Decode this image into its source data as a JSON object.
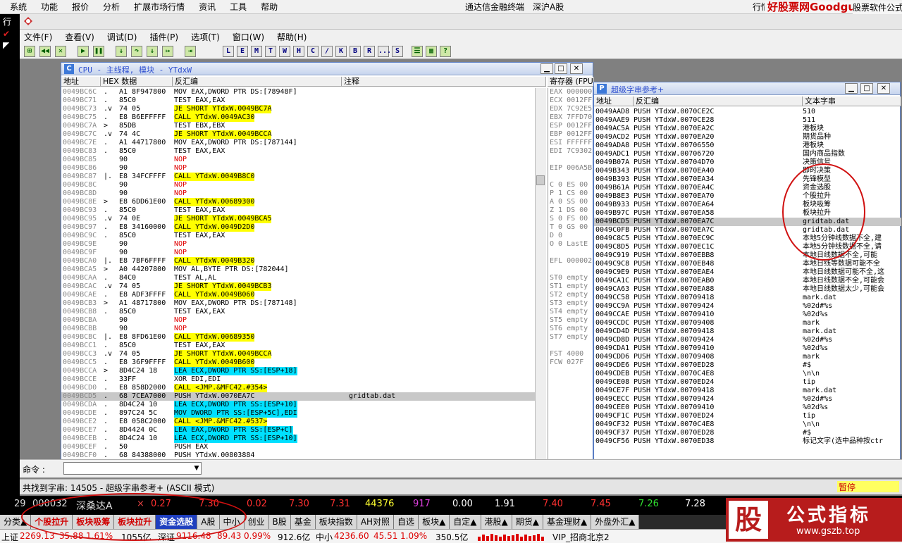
{
  "tdx_menu": [
    "系统",
    "功能",
    "报价",
    "分析",
    "扩展市场行情",
    "资讯",
    "工具",
    "帮助"
  ],
  "tdx_title": "通达信金融终端",
  "tdx_market": "深沪A股",
  "tdx_right": "行情",
  "watermark": "好股票网Goodgupiao.com",
  "watermark2": "股票软件公式",
  "left_labels": [
    "行",
    "✔",
    "◤"
  ],
  "od_menu": [
    "文件(F)",
    "查看(V)",
    "调试(D)",
    "插件(P)",
    "选项(T)",
    "窗口(W)",
    "帮助(H)"
  ],
  "od_toolbar_letters": [
    "L",
    "E",
    "M",
    "T",
    "W",
    "H",
    "C",
    "/",
    "K",
    "B",
    "R",
    "...",
    "S"
  ],
  "cpu": {
    "title": "CPU - 主线程, 模块 - YTdxW",
    "col_address": "地址",
    "col_hex": "HEX 数据",
    "col_asm": "反汇编",
    "col_comment": "注释",
    "rows": [
      {
        "a": "0049BC6C",
        "m": ".",
        "h": "A1 8F947800",
        "d": "MOV EAX,DWORD PTR DS:[78948F]",
        "c": ""
      },
      {
        "a": "0049BC71",
        "m": ".",
        "h": "85C0",
        "d": "TEST EAX,EAX",
        "c": ""
      },
      {
        "a": "0049BC73",
        "m": ".v",
        "h": "74 05",
        "d": "JE SHORT YTdxW.0049BC7A",
        "c": ""
      },
      {
        "a": "0049BC75",
        "m": ".",
        "h": "E8 B6EFFFFF",
        "d": "CALL YTdxW.0049AC30",
        "c": ""
      },
      {
        "a": "0049BC7A",
        "m": ">",
        "h": "85DB",
        "d": "TEST EBX,EBX",
        "c": ""
      },
      {
        "a": "0049BC7C",
        "m": ".v",
        "h": "74 4C",
        "d": "JE SHORT YTdxW.0049BCCA",
        "c": ""
      },
      {
        "a": "0049BC7E",
        "m": ".",
        "h": "A1 44717800",
        "d": "MOV EAX,DWORD PTR DS:[787144]",
        "c": ""
      },
      {
        "a": "0049BC83",
        "m": ".",
        "h": "85C0",
        "d": "TEST EAX,EAX",
        "c": ""
      },
      {
        "a": "0049BC85",
        "m": "",
        "h": "90",
        "d": "NOP",
        "c": ""
      },
      {
        "a": "0049BC86",
        "m": "",
        "h": "90",
        "d": "NOP",
        "c": ""
      },
      {
        "a": "0049BC87",
        "m": "|.",
        "h": "E8 34FCFFFF",
        "d": "CALL YTdxW.0049B8C0",
        "c": ""
      },
      {
        "a": "0049BC8C",
        "m": "",
        "h": "90",
        "d": "NOP",
        "c": ""
      },
      {
        "a": "0049BC8D",
        "m": "",
        "h": "90",
        "d": "NOP",
        "c": ""
      },
      {
        "a": "0049BC8E",
        "m": ">",
        "h": "E8 6DD61E00",
        "d": "CALL YTdxW.00689300",
        "c": ""
      },
      {
        "a": "0049BC93",
        "m": ".",
        "h": "85C0",
        "d": "TEST EAX,EAX",
        "c": ""
      },
      {
        "a": "0049BC95",
        "m": ".v",
        "h": "74 0E",
        "d": "JE SHORT YTdxW.0049BCA5",
        "c": ""
      },
      {
        "a": "0049BC97",
        "m": ".",
        "h": "E8 34160000",
        "d": "CALL YTdxW.0049D2D0",
        "c": ""
      },
      {
        "a": "0049BC9C",
        "m": ".",
        "h": "85C0",
        "d": "TEST EAX,EAX",
        "c": ""
      },
      {
        "a": "0049BC9E",
        "m": "",
        "h": "90",
        "d": "NOP",
        "c": ""
      },
      {
        "a": "0049BC9F",
        "m": "",
        "h": "90",
        "d": "NOP",
        "c": ""
      },
      {
        "a": "0049BCA0",
        "m": "|.",
        "h": "E8 7BF6FFFF",
        "d": "CALL YTdxW.0049B320",
        "c": ""
      },
      {
        "a": "0049BCA5",
        "m": ">",
        "h": "A0 44207800",
        "d": "MOV AL,BYTE PTR DS:[782044]",
        "c": ""
      },
      {
        "a": "0049BCAA",
        "m": ".",
        "h": "84C0",
        "d": "TEST AL,AL",
        "c": ""
      },
      {
        "a": "0049BCAC",
        "m": ".v",
        "h": "74 05",
        "d": "JE SHORT YTdxW.0049BCB3",
        "c": ""
      },
      {
        "a": "0049BCAE",
        "m": ".",
        "h": "E8 ADF3FFFF",
        "d": "CALL YTdxW.0049B060",
        "c": ""
      },
      {
        "a": "0049BCB3",
        "m": ">",
        "h": "A1 48717800",
        "d": "MOV EAX,DWORD PTR DS:[787148]",
        "c": ""
      },
      {
        "a": "0049BCB8",
        "m": ".",
        "h": "85C0",
        "d": "TEST EAX,EAX",
        "c": ""
      },
      {
        "a": "0049BCBA",
        "m": "",
        "h": "90",
        "d": "NOP",
        "c": ""
      },
      {
        "a": "0049BCBB",
        "m": "",
        "h": "90",
        "d": "NOP",
        "c": ""
      },
      {
        "a": "0049BCBC",
        "m": "|.",
        "h": "E8 8FD61E00",
        "d": "CALL YTdxW.00689350",
        "c": ""
      },
      {
        "a": "0049BCC1",
        "m": ".",
        "h": "85C0",
        "d": "TEST EAX,EAX",
        "c": ""
      },
      {
        "a": "0049BCC3",
        "m": ".v",
        "h": "74 05",
        "d": "JE SHORT YTdxW.0049BCCA",
        "c": ""
      },
      {
        "a": "0049BCC5",
        "m": ".",
        "h": "E8 36F9FFFF",
        "d": "CALL YTdxW.0049B600",
        "c": ""
      },
      {
        "a": "0049BCCA",
        "m": ">",
        "h": "8D4C24 18",
        "d": "LEA ECX,DWORD PTR SS:[ESP+18]",
        "c": ""
      },
      {
        "a": "0049BCCE",
        "m": ".",
        "h": "33FF",
        "d": "XOR EDI,EDI",
        "c": ""
      },
      {
        "a": "0049BCD0",
        "m": ".",
        "h": "E8 858D2000",
        "d": "CALL <JMP.&MFC42.#354>",
        "c": ""
      },
      {
        "a": "0049BCD5",
        "m": ".",
        "h": "68 7CEA7000",
        "d": "PUSH YTdxW.0070EA7C",
        "c": "gridtab.dat"
      },
      {
        "a": "0049BCDA",
        "m": ".",
        "h": "8D4C24 10",
        "d": "LEA ECX,DWORD PTR SS:[ESP+10]",
        "c": ""
      },
      {
        "a": "0049BCDE",
        "m": ".",
        "h": "897C24 5C",
        "d": "MOV DWORD PTR SS:[ESP+5C],EDI",
        "c": ""
      },
      {
        "a": "0049BCE2",
        "m": ".",
        "h": "E8 058C2000",
        "d": "CALL <JMP.&MFC42.#537>",
        "c": ""
      },
      {
        "a": "0049BCE7",
        "m": ".",
        "h": "8D4424 0C",
        "d": "LEA EAX,DWORD PTR SS:[ESP+C]",
        "c": ""
      },
      {
        "a": "0049BCEB",
        "m": ".",
        "h": "8D4C24 10",
        "d": "LEA ECX,DWORD PTR SS:[ESP+10]",
        "c": ""
      },
      {
        "a": "0049BCEF",
        "m": ".",
        "h": "50",
        "d": "PUSH EAX",
        "c": ""
      },
      {
        "a": "0049BCF0",
        "m": ".",
        "h": "68 84388000",
        "d": "PUSH YTdxW.00803884",
        "c": ""
      }
    ]
  },
  "regs": {
    "header": "寄存器 (FPU)",
    "lines": [
      "EAX 000000",
      "ECX 0012FF",
      "EDX 7C92E5",
      "EBX 7FFD70",
      "ESP 0012FF",
      "EBP 0012FF",
      "ESI FFFFFF",
      "EDI 7C9302",
      "",
      "EIP 006A5B",
      "",
      "C 0  ES 00",
      "P 1  CS 00",
      "A 0  SS 00",
      "Z 1  DS 00",
      "S 0  FS 00",
      "T 0  GS 00",
      "D 0",
      "O 0  LastE",
      "",
      "EFL 000002",
      "",
      "ST0 empty",
      "ST1 empty",
      "ST2 empty",
      "ST3 empty",
      "ST4 empty",
      "ST5 empty",
      "ST6 empty",
      "ST7 empty",
      "",
      "FST 4000",
      "FCW 027F"
    ]
  },
  "strings": {
    "title": "超级字串参考+",
    "col_address": "地址",
    "col_asm": "反汇编",
    "col_text": "文本字串",
    "rows": [
      {
        "a": "0049AAD8",
        "d": "PUSH YTdxW.0070CE2C",
        "t": "510"
      },
      {
        "a": "0049AAE9",
        "d": "PUSH YTdxW.0070CE28",
        "t": "511"
      },
      {
        "a": "0049AC5A",
        "d": "PUSH YTdxW.0070EA2C",
        "t": "港板块"
      },
      {
        "a": "0049ACD2",
        "d": "PUSH YTdxW.0070EA20",
        "t": "期货品种"
      },
      {
        "a": "0049ADA8",
        "d": "PUSH YTdxW.00706550",
        "t": "港板块"
      },
      {
        "a": "0049ADC1",
        "d": "PUSH YTdxW.00706720",
        "t": "国内商品指数"
      },
      {
        "a": "0049B07A",
        "d": "PUSH YTdxW.00704D70",
        "t": "决策信号"
      },
      {
        "a": "0049B343",
        "d": "PUSH YTdxW.0070EA40",
        "t": "即时决策"
      },
      {
        "a": "0049B393",
        "d": "PUSH YTdxW.0070EA34",
        "t": "先锋模型"
      },
      {
        "a": "0049B61A",
        "d": "PUSH YTdxW.0070EA4C",
        "t": "资金选股"
      },
      {
        "a": "0049B8E3",
        "d": "PUSH YTdxW.0070EA70",
        "t": "个股拉升"
      },
      {
        "a": "0049B933",
        "d": "PUSH YTdxW.0070EA64",
        "t": "板块吸筹"
      },
      {
        "a": "0049B97C",
        "d": "PUSH YTdxW.0070EA58",
        "t": "板块拉升"
      },
      {
        "a": "0049BCD5",
        "d": "PUSH YTdxW.0070EA7C",
        "t": "gridtab.dat"
      },
      {
        "a": "0049C0FB",
        "d": "PUSH YTdxW.0070EA7C",
        "t": "gridtab.dat"
      },
      {
        "a": "0049C8C5",
        "d": "PUSH YTdxW.0070EC9C",
        "t": "本地5分钟线数据不全,建"
      },
      {
        "a": "0049C8D5",
        "d": "PUSH YTdxW.0070EC1C",
        "t": "本地5分钟线数据不全,请"
      },
      {
        "a": "0049C919",
        "d": "PUSH YTdxW.0070EBB8",
        "t": "本地日线数据不全,可能"
      },
      {
        "a": "0049C9C8",
        "d": "PUSH YTdxW.0070EB48",
        "t": "本地日线等数据可能不全"
      },
      {
        "a": "0049C9E9",
        "d": "PUSH YTdxW.0070EAE4",
        "t": "本地日线数据可能不全,这"
      },
      {
        "a": "0049CA1C",
        "d": "PUSH YTdxW.0070EAB0",
        "t": "本地日线数据不全,可能会"
      },
      {
        "a": "0049CA63",
        "d": "PUSH YTdxW.0070EA88",
        "t": "本地日线数据太少,可能会"
      },
      {
        "a": "0049CC58",
        "d": "PUSH YTdxW.00709418",
        "t": "mark.dat"
      },
      {
        "a": "0049CC9A",
        "d": "PUSH YTdxW.00709424",
        "t": "%02d#%s"
      },
      {
        "a": "0049CCAE",
        "d": "PUSH YTdxW.00709410",
        "t": "%02d%s"
      },
      {
        "a": "0049CCDC",
        "d": "PUSH YTdxW.00709408",
        "t": "mark"
      },
      {
        "a": "0049CD4D",
        "d": "PUSH YTdxW.00709418",
        "t": "mark.dat"
      },
      {
        "a": "0049CD8D",
        "d": "PUSH YTdxW.00709424",
        "t": "%02d#%s"
      },
      {
        "a": "0049CDA1",
        "d": "PUSH YTdxW.00709410",
        "t": "%02d%s"
      },
      {
        "a": "0049CDD6",
        "d": "PUSH YTdxW.00709408",
        "t": "mark"
      },
      {
        "a": "0049CDE6",
        "d": "PUSH YTdxW.0070ED28",
        "t": "#$"
      },
      {
        "a": "0049CDEB",
        "d": "PUSH YTdxW.0070C4E8",
        "t": "\\n\\n"
      },
      {
        "a": "0049CE08",
        "d": "PUSH YTdxW.0070ED24",
        "t": "tip"
      },
      {
        "a": "0049CE7F",
        "d": "PUSH YTdxW.00709418",
        "t": "mark.dat"
      },
      {
        "a": "0049CECC",
        "d": "PUSH YTdxW.00709424",
        "t": "%02d#%s"
      },
      {
        "a": "0049CEE0",
        "d": "PUSH YTdxW.00709410",
        "t": "%02d%s"
      },
      {
        "a": "0049CF1C",
        "d": "PUSH YTdxW.0070ED24",
        "t": "tip"
      },
      {
        "a": "0049CF32",
        "d": "PUSH YTdxW.0070C4E8",
        "t": "\\n\\n"
      },
      {
        "a": "0049CF37",
        "d": "PUSH YTdxW.0070ED28",
        "t": "#$"
      },
      {
        "a": "0049CF56",
        "d": "PUSH YTdxW.0070ED38",
        "t": "标记文字(选中品种按ctr"
      }
    ]
  },
  "cmd_label": "命令 :",
  "status_text": "共找到字串: 14505 - 超级字串参考+ (ASCII 模式)",
  "status_right": "暂停",
  "quote": {
    "no": "29",
    "code": "000032",
    "name": "深桑达A",
    "mark": "×",
    "v1": "0.27",
    "v2": "7.30",
    "v3": "0.02",
    "v4": "7.30",
    "v5": "7.31",
    "v6": "44376",
    "v7": "917",
    "v8": "0.00",
    "v9": "1.91",
    "v10": "7.40",
    "v11": "7.45",
    "v12": "7.26",
    "v13": "7.28"
  },
  "tabs": [
    "分类▲",
    "个股拉升",
    "板块吸筹",
    "板块拉升",
    "资金选股",
    "A股",
    "中小",
    "创业",
    "B股",
    "基金",
    "板块指数",
    "AH对照",
    "自选",
    "板块▲",
    "自定▲",
    "港股▲",
    "期货▲",
    "基金理财▲",
    "外盘外汇▲"
  ],
  "idx": {
    "sh_label": "上证",
    "sh_val": "2269.13",
    "sh_chg": "35.88",
    "sh_pct": "1.61%",
    "sh_amt": "1055亿",
    "sz_label": "深证",
    "sz_val": "9116.48",
    "sz_chg": "89.43",
    "sz_pct": "0.99%",
    "sz_amt": "912.6亿",
    "zx_label": "中小",
    "zx_val": "4236.60",
    "zx_chg": "45.51",
    "zx_pct": "1.09%",
    "zx_amt": "350.5亿",
    "vip": "VIP_招商北京2"
  },
  "ad": {
    "main": "公式指标",
    "url": "www.gszb.top",
    "logo": "股"
  },
  "colors": {
    "red": "#ff2020",
    "green": "#20d020",
    "yellow": "#ffff00",
    "cyan": "#00e0ff"
  }
}
